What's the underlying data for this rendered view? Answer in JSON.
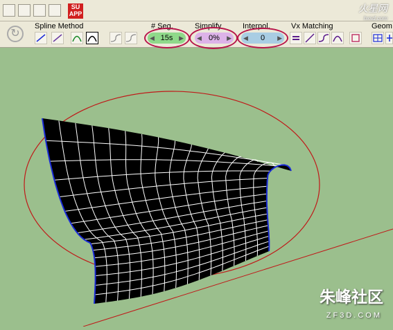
{
  "toolbar_top": {
    "icons": [
      "plugin-icon-1",
      "plugin-icon-2",
      "plugin-icon-3",
      "plugin-icon-4"
    ],
    "su_app": {
      "line1": "SU",
      "line2": "APP"
    },
    "watermark": {
      "text": "火星网",
      "sub": "hxsd.com"
    }
  },
  "toolbar": {
    "spline_method_label": "Spline Method",
    "seg_label": "# Seg.",
    "seg_value": "15s",
    "simplify_label": "Simplify",
    "simplify_value": "0%",
    "interpol_label": "Interpol.",
    "interpol_value": "0",
    "vx_matching_label": "Vx Matching",
    "geom_label": "Geom"
  },
  "colors": {
    "background": "#9bbf8d",
    "highlight": "#b8154a",
    "guide_ellipse": "#c01818",
    "axis_line": "#c01818",
    "mesh_fill": "#000000",
    "mesh_lines": "#ffffff",
    "mesh_edge": "#1a2bd6"
  },
  "watermark_bottom": {
    "logo": "朱峰社区",
    "site": "ZF3D.COM"
  }
}
